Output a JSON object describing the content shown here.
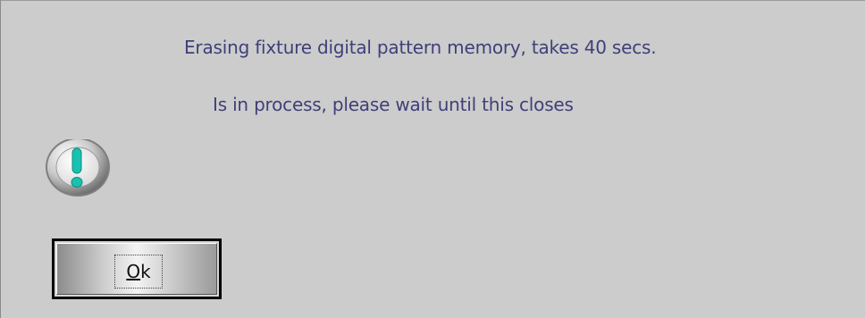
{
  "dialog": {
    "message_line1": "Erasing fixture digital pattern memory, takes 40 secs.",
    "message_line2": "Is in process, please wait until this closes",
    "icon": "exclamation-icon",
    "ok_button": {
      "mnemonic": "O",
      "rest": "k"
    }
  },
  "colors": {
    "background": "#cccccc",
    "message_text": "#3f3f7a",
    "icon_accent": "#19c2b0"
  }
}
